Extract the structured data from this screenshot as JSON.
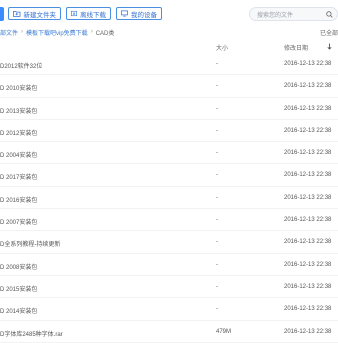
{
  "toolbar": {
    "new_folder": "新建文件夹",
    "offline_download": "离线下载",
    "my_devices": "我的设备"
  },
  "search": {
    "placeholder": "搜索您的文件"
  },
  "breadcrumb": {
    "items": [
      "部文件",
      "模板下载吧vip免费下载",
      "CAD类"
    ]
  },
  "loaded_label": "已全部",
  "columns": {
    "size": "大小",
    "date": "修改日期"
  },
  "files": [
    {
      "name": "D2012软件32位",
      "size": "-",
      "date": "2016-12-13 22:38"
    },
    {
      "name": "D 2010安装包",
      "size": "-",
      "date": "2016-12-13 22:38"
    },
    {
      "name": "D 2013安装包",
      "size": "-",
      "date": "2016-12-13 22:38"
    },
    {
      "name": "D 2012安装包",
      "size": "-",
      "date": "2016-12-13 22:38"
    },
    {
      "name": "D 2004安装包",
      "size": "-",
      "date": "2016-12-13 22:38"
    },
    {
      "name": "D 2017安装包",
      "size": "-",
      "date": "2016-12-13 22:38"
    },
    {
      "name": "D 2016安装包",
      "size": "-",
      "date": "2016-12-13 22:38"
    },
    {
      "name": "D 2007安装包",
      "size": "-",
      "date": "2016-12-13 22:38"
    },
    {
      "name": "D全系列教程-持续更新",
      "size": "-",
      "date": "2016-12-13 22:38"
    },
    {
      "name": "D 2008安装包",
      "size": "-",
      "date": "2016-12-13 22:38"
    },
    {
      "name": "D 2015安装包",
      "size": "-",
      "date": "2016-12-13 22:38"
    },
    {
      "name": "D 2014安装包",
      "size": "-",
      "date": "2016-12-13 22:38"
    },
    {
      "name": "D字体库2485种字体.rar",
      "size": "479M",
      "date": "2016-12-13 22:38"
    }
  ]
}
